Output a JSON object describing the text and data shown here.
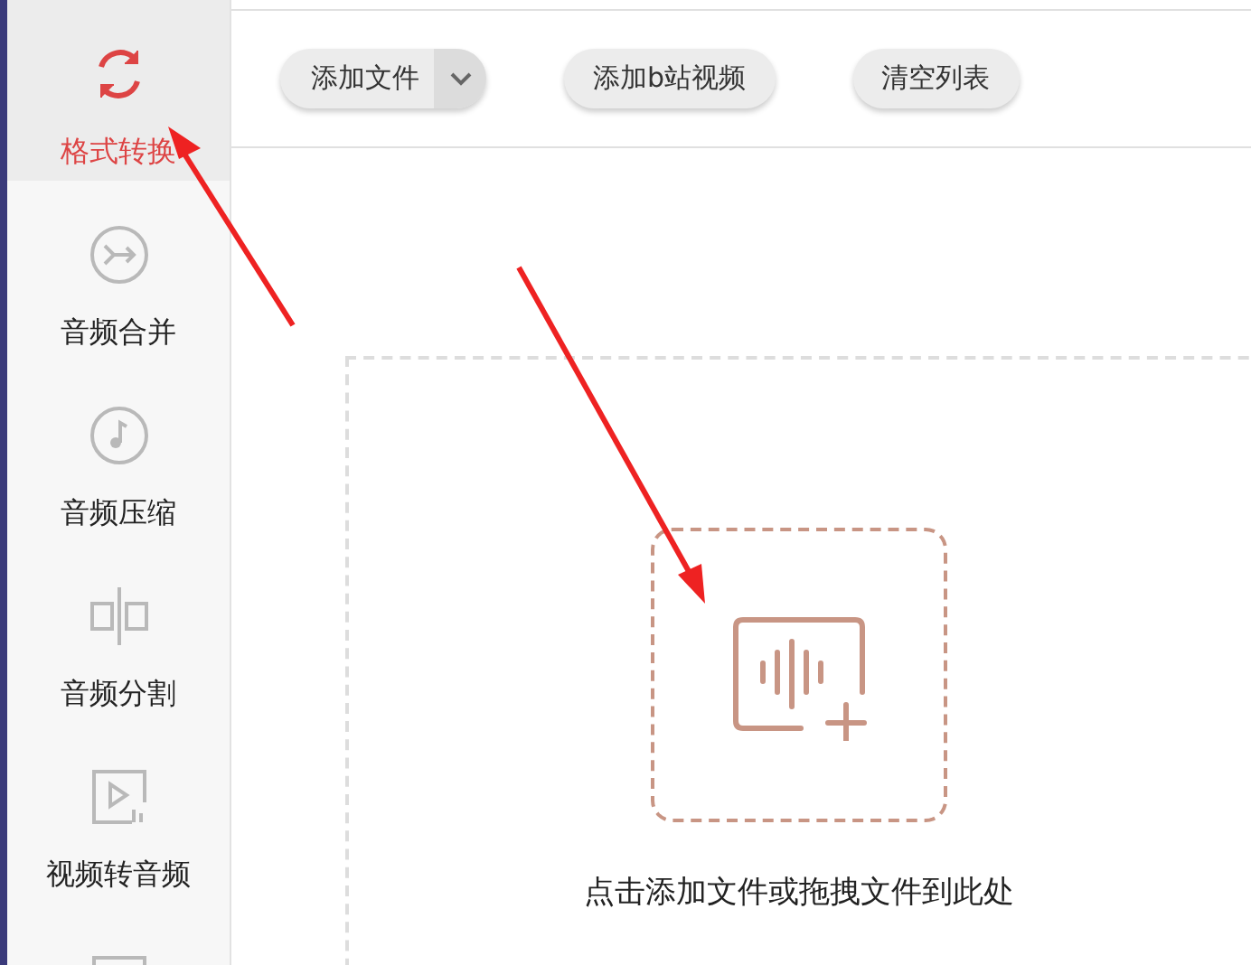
{
  "sidebar": {
    "items": [
      {
        "kind": "convert",
        "label": "格式转换",
        "selected": true
      },
      {
        "kind": "merge",
        "label": "音频合并",
        "selected": false
      },
      {
        "kind": "compress",
        "label": "音频压缩",
        "selected": false
      },
      {
        "kind": "split",
        "label": "音频分割",
        "selected": false
      },
      {
        "kind": "video",
        "label": "视频转音频",
        "selected": false
      },
      {
        "kind": "tv",
        "selected": false
      }
    ]
  },
  "toolbar": {
    "buttons": [
      {
        "kind": "dropdown",
        "label": "添加文件"
      },
      {
        "kind": "plain",
        "label": "添加b站视频"
      },
      {
        "kind": "plain",
        "label": "清空列表"
      }
    ]
  },
  "drop_area": {
    "hint": "点击添加文件或拖拽文件到此处"
  }
}
